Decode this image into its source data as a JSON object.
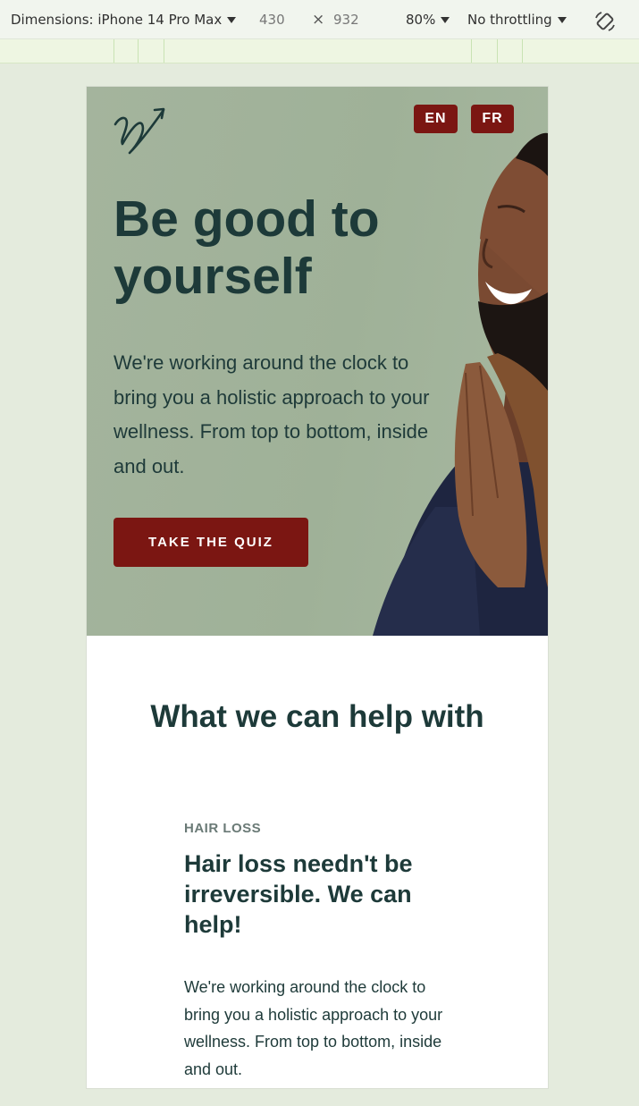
{
  "devtools": {
    "device_label": "Dimensions: iPhone 14 Pro Max",
    "width": "430",
    "times": "×",
    "height": "932",
    "zoom": "80%",
    "throttling": "No throttling",
    "rotate_icon": "rotate-icon"
  },
  "hero": {
    "logo_icon": "signature-arrow-logo",
    "lang_en": "EN",
    "lang_fr": "FR",
    "title": "Be good to yourself",
    "text": "We're working around the clock to bring you a holistic approach to your wellness. From top to bottom, inside and out.",
    "cta": "TAKE THE QUIZ",
    "image": "smiling-man-praying-hands"
  },
  "help": {
    "title": "What we can help with",
    "eyebrow": "HAIR LOSS",
    "card_title": "Hair loss needn't be irreversible. We can help!",
    "card_text": "We're working around the clock to bring you a holistic approach to your wellness. From top to bottom, inside and out."
  },
  "colors": {
    "brand_red": "#7b1612",
    "heading_green": "#1d3a39",
    "hero_bg": "#a2b39b",
    "page_bg": "#e4ebdd"
  }
}
